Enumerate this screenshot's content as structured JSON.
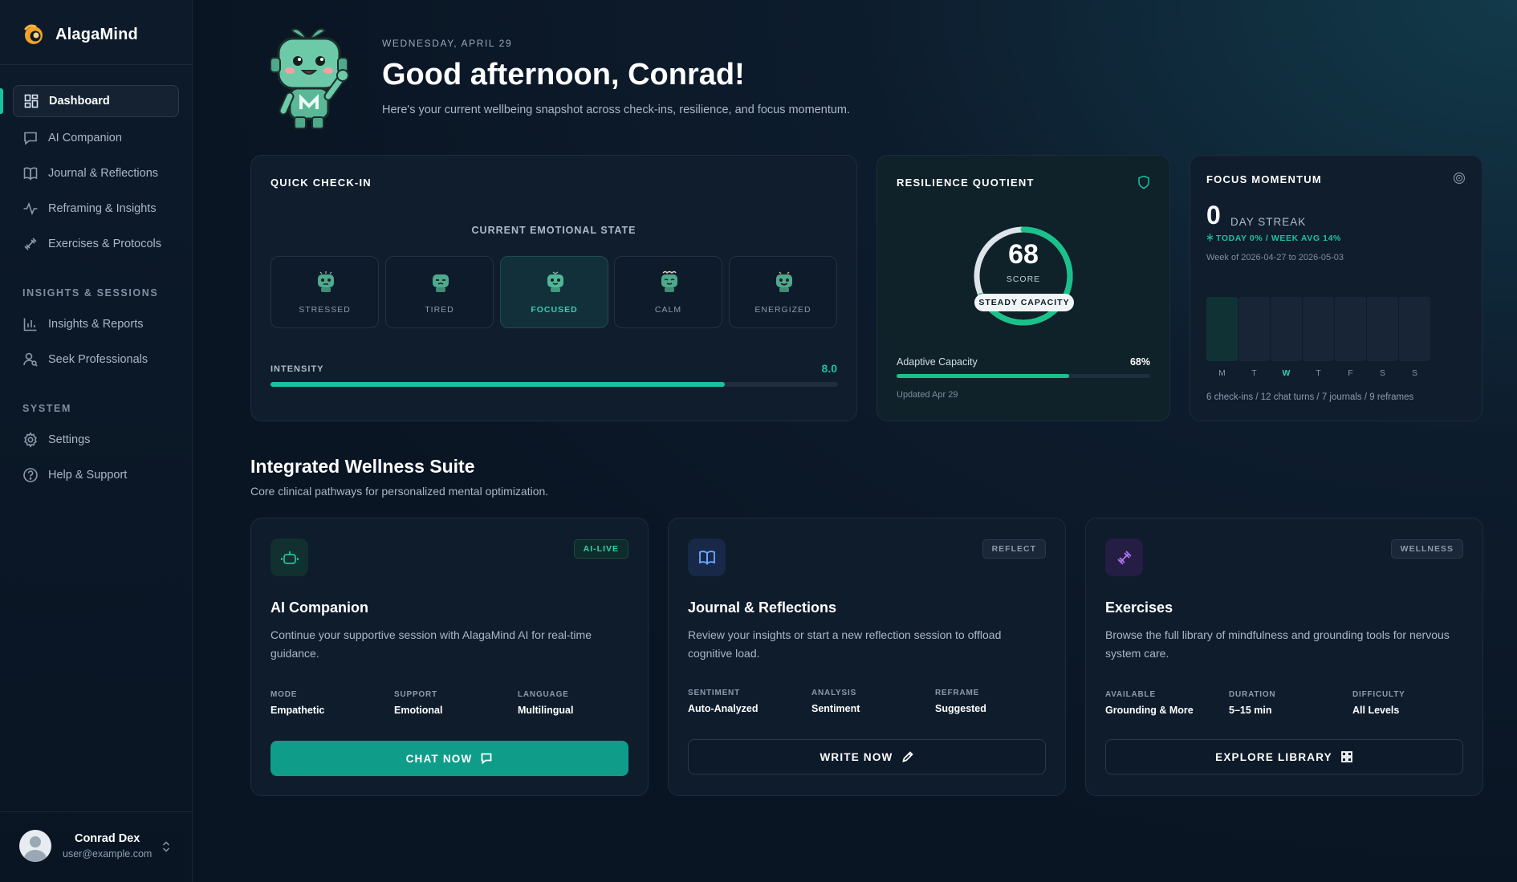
{
  "app": {
    "name": "AlagaMind"
  },
  "sidebar": {
    "nav": [
      {
        "label": "Dashboard",
        "icon": "dashboard-grid-icon"
      },
      {
        "label": "AI Companion",
        "icon": "chat-bubble-icon"
      },
      {
        "label": "Journal & Reflections",
        "icon": "book-icon"
      },
      {
        "label": "Reframing & Insights",
        "icon": "activity-pulse-icon"
      },
      {
        "label": "Exercises & Protocols",
        "icon": "dumbbell-icon"
      }
    ],
    "section_insights": "INSIGHTS & SESSIONS",
    "insights_items": [
      {
        "label": "Insights & Reports",
        "icon": "bar-chart-icon"
      },
      {
        "label": "Seek Professionals",
        "icon": "user-search-icon"
      }
    ],
    "section_system": "SYSTEM",
    "system_items": [
      {
        "label": "Settings",
        "icon": "gear-icon"
      },
      {
        "label": "Help & Support",
        "icon": "help-circle-icon"
      }
    ],
    "user": {
      "name": "Conrad Dex",
      "email": "user@example.com"
    }
  },
  "header": {
    "date": "WEDNESDAY, APRIL 29",
    "greeting": "Good afternoon, Conrad!",
    "subtitle": "Here's your current wellbeing snapshot across check-ins, resilience, and focus momentum."
  },
  "checkin": {
    "title": "QUICK CHECK-IN",
    "state_heading": "CURRENT EMOTIONAL STATE",
    "moods": [
      "STRESSED",
      "TIRED",
      "FOCUSED",
      "CALM",
      "ENERGIZED"
    ],
    "selected_mood": "FOCUSED",
    "intensity_label": "INTENSITY",
    "intensity_value": "8.0",
    "intensity_fraction": 0.8
  },
  "resilience": {
    "title": "RESILIENCE QUOTIENT",
    "score": "68",
    "score_caption": "SCORE",
    "score_fraction": 0.68,
    "capacity_pill": "STEADY CAPACITY",
    "adaptive_label": "Adaptive Capacity",
    "adaptive_value": "68%",
    "adaptive_fraction": 0.68,
    "updated": "Updated Apr 29"
  },
  "focus": {
    "title": "FOCUS MOMENTUM",
    "streak": "0",
    "streak_label": "DAY STREAK",
    "stats": "TODAY 0% / WEEK AVG 14%",
    "week_range": "Week of 2026-04-27 to 2026-05-03",
    "days": [
      "M",
      "T",
      "W",
      "T",
      "F",
      "S",
      "S"
    ],
    "today_index": 2,
    "activity": "6 check-ins / 12 chat turns / 7 journals / 9 reframes"
  },
  "suite": {
    "title": "Integrated Wellness Suite",
    "subtitle": "Core clinical pathways for personalized mental optimization.",
    "cards": [
      {
        "badge": "AI-LIVE",
        "name": "AI Companion",
        "description": "Continue your supportive session with AlagaMind AI for real-time guidance.",
        "meta": [
          {
            "key": "MODE",
            "value": "Empathetic"
          },
          {
            "key": "SUPPORT",
            "value": "Emotional"
          },
          {
            "key": "LANGUAGE",
            "value": "Multilingual"
          }
        ],
        "button": "CHAT NOW",
        "icon": "robot-icon"
      },
      {
        "badge": "REFLECT",
        "name": "Journal & Reflections",
        "description": "Review your insights or start a new reflection session to offload cognitive load.",
        "meta": [
          {
            "key": "SENTIMENT",
            "value": "Auto-Analyzed"
          },
          {
            "key": "ANALYSIS",
            "value": "Sentiment"
          },
          {
            "key": "REFRAME",
            "value": "Suggested"
          }
        ],
        "button": "WRITE NOW",
        "icon": "book-open-icon"
      },
      {
        "badge": "WELLNESS",
        "name": "Exercises",
        "description": "Browse the full library of mindfulness and grounding tools for nervous system care.",
        "meta": [
          {
            "key": "AVAILABLE",
            "value": "Grounding & More"
          },
          {
            "key": "DURATION",
            "value": "5–15 min"
          },
          {
            "key": "DIFFICULTY",
            "value": "All Levels"
          }
        ],
        "button": "EXPLORE LIBRARY",
        "icon": "dumbbell-icon"
      }
    ]
  },
  "colors": {
    "accent": "#19c2a0",
    "background": "#0b1422",
    "card": "#0f1d2d",
    "journal_accent": "#6fa8ff",
    "exercise_accent": "#b277f0"
  }
}
